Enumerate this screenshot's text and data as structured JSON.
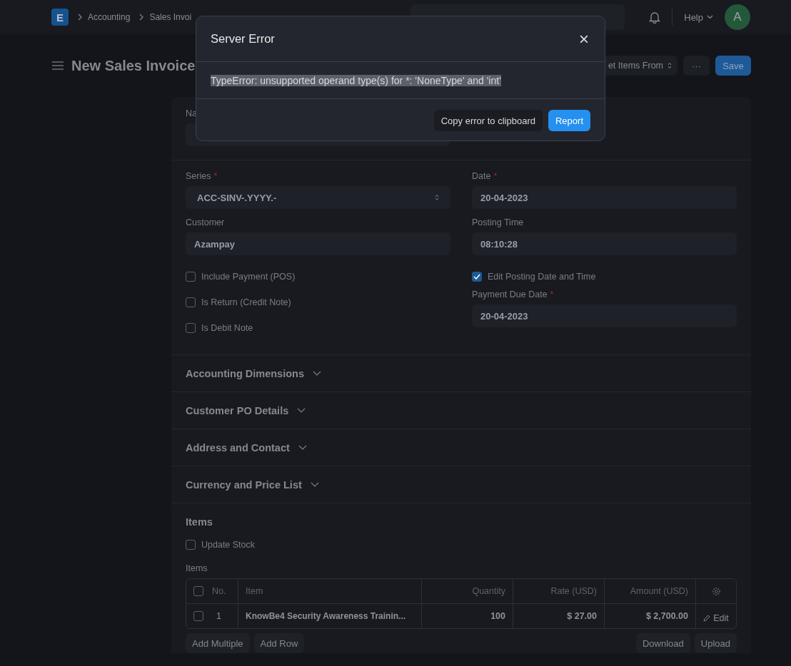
{
  "navbar": {
    "logo": "E",
    "breadcrumbs": [
      "Accounting",
      "Sales Invoi"
    ],
    "help": "Help",
    "avatar": "A"
  },
  "page": {
    "title": "New Sales Invoice",
    "actions": [
      {
        "label": "et Items From",
        "kind": "select"
      },
      {
        "label": "···",
        "kind": "menu"
      },
      {
        "label": "Save",
        "kind": "primary"
      }
    ]
  },
  "form": {
    "naming_label": "Na",
    "columns": [
      [
        {
          "kind": "select",
          "label": "Series",
          "mark": "*",
          "value": "ACC-SINV-.YYYY.-"
        },
        {
          "kind": "input",
          "label": "Customer",
          "value": "Azampay"
        },
        {
          "kind": "checkbox",
          "label": "Include Payment (POS)",
          "checked": false
        },
        {
          "kind": "checkbox",
          "label": "Is Return (Credit Note)",
          "checked": false
        },
        {
          "kind": "checkbox",
          "label": "Is Debit Note",
          "checked": false
        }
      ],
      [
        {
          "kind": "input",
          "label": "Date",
          "mark": "*",
          "value": "20-04-2023"
        },
        {
          "kind": "input",
          "label": "Posting Time",
          "value": "08:10:28"
        },
        {
          "kind": "checkbox",
          "label": "Edit Posting Date and Time",
          "checked": true
        },
        {
          "kind": "input",
          "label": "Payment Due Date",
          "mark": "*",
          "value": "20-04-2023"
        }
      ]
    ],
    "sections": [
      {
        "title": "Accounting Dimensions",
        "expanded": false
      },
      {
        "title": "Customer PO Details",
        "expanded": false
      },
      {
        "title": "Address and Contact",
        "expanded": false
      },
      {
        "title": "Currency and Price List",
        "expanded": false
      }
    ],
    "items": {
      "title": "Items",
      "update_stock": {
        "label": "Update Stock",
        "checked": false
      },
      "table_label": "Items",
      "all_checked": false,
      "columns": [
        "No.",
        "Item",
        "Quantity",
        "Rate (USD)",
        "Amount (USD)"
      ],
      "rows": [
        {
          "checked": false,
          "cells": [
            "1",
            "KnowBe4 Security Awareness Trainin...",
            "100",
            "$ 27.00",
            "$ 2,700.00"
          ],
          "edit": "Edit"
        }
      ],
      "left_buttons": [
        "Add Multiple",
        "Add Row"
      ],
      "right_buttons": [
        "Download",
        "Upload"
      ]
    }
  },
  "dialog": {
    "title": "Server Error",
    "close": "×",
    "message": "TypeError: unsupported operand type(s) for *: 'NoneType' and 'int'",
    "message_highlighted": true,
    "buttons": [
      {
        "label": "Copy error to clipboard",
        "kind": "secondary"
      },
      {
        "label": "Report",
        "kind": "primary"
      }
    ]
  }
}
